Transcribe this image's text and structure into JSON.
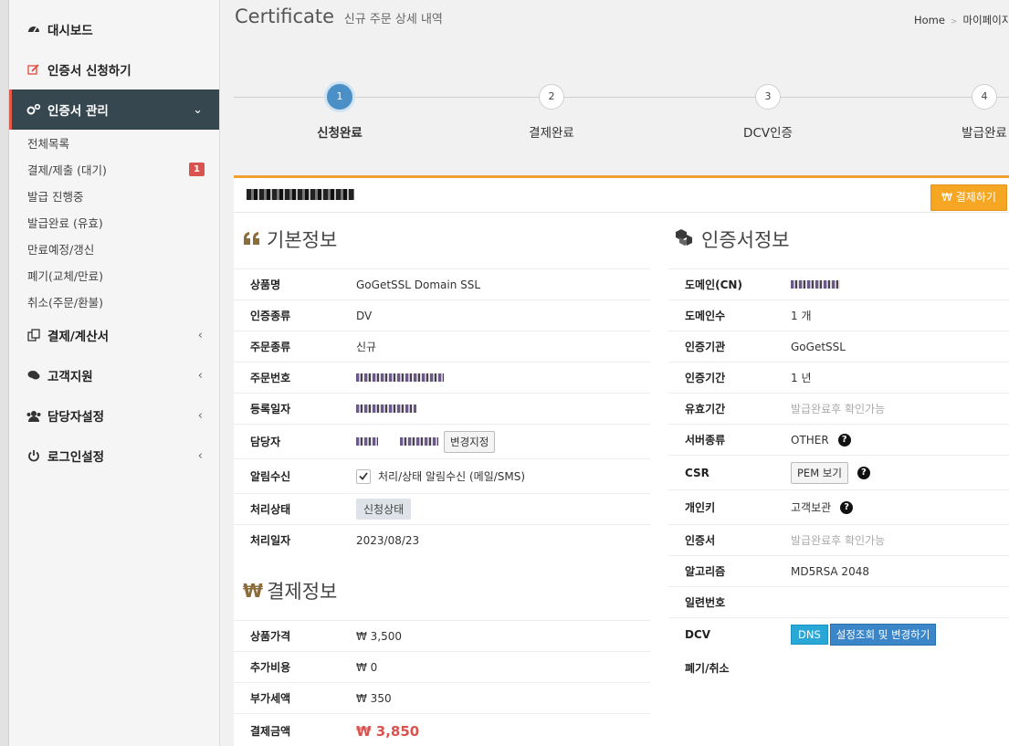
{
  "sidebar": {
    "dashboard": "대시보드",
    "apply": "인증서 신청하기",
    "manage": "인증서 관리",
    "sub": [
      "전체목록",
      "결제/제출 (대기)",
      "발급 진행중",
      "발급완료 (유효)",
      "만료예정/갱신",
      "폐기(교체/만료)",
      "취소(주문/환불)"
    ],
    "pending_count": "1",
    "payment": "결제/계산서",
    "support": "고객지원",
    "contacts": "담당자설정",
    "login": "로그인설정"
  },
  "header": {
    "title": "Certificate",
    "subtitle": "신규 주문 상세 내역",
    "breadcrumb_home": "Home",
    "breadcrumb_page": "마이페이지"
  },
  "steps": [
    {
      "num": "1",
      "label": "신청완료"
    },
    {
      "num": "2",
      "label": "결제완료"
    },
    {
      "num": "3",
      "label": "DCV인증"
    },
    {
      "num": "4",
      "label": "발급완료"
    }
  ],
  "panel": {
    "pay_button": "₩ 결제하기"
  },
  "basic": {
    "heading": "기본정보",
    "product_label": "상품명",
    "product_value": "GoGetSSL Domain SSL",
    "certtype_label": "인증종류",
    "certtype_value": "DV",
    "ordertype_label": "주문종류",
    "ordertype_value": "신규",
    "orderno_label": "주문번호",
    "regdate_label": "등록일자",
    "manager_label": "담당자",
    "manager_button": "변경지정",
    "notify_label": "알림수신",
    "notify_value": "처리/상태 알림수신 (메일/SMS)",
    "status_label": "처리상태",
    "status_value": "신청상태",
    "procdate_label": "처리일자",
    "procdate_value": "2023/08/23"
  },
  "payment": {
    "heading": "결제정보",
    "price_label": "상품가격",
    "price_value": "₩ 3,500",
    "extra_label": "추가비용",
    "extra_value": "₩ 0",
    "vat_label": "부가세액",
    "vat_value": "₩ 350",
    "total_label": "결제금액",
    "total_value": "₩ 3,850"
  },
  "cert": {
    "heading": "인증서정보",
    "domain_label": "도메인(CN)",
    "domains_label": "도메인수",
    "domains_value": "1 개",
    "ca_label": "인증기관",
    "ca_value": "GoGetSSL",
    "period_label": "인증기간",
    "period_value": "1 년",
    "valid_label": "유효기간",
    "valid_value": "발급완료후 확인가능",
    "server_label": "서버종류",
    "server_value": "OTHER",
    "csr_label": "CSR",
    "csr_button": "PEM 보기",
    "key_label": "개인키",
    "key_value": "고객보관",
    "certfile_label": "인증서",
    "certfile_value": "발급완료후 확인가능",
    "algo_label": "알고리즘",
    "algo_value": "MD5RSA 2048",
    "serial_label": "일련번호",
    "dcv_label": "DCV",
    "dcv_badge": "DNS",
    "dcv_button": "설정조회 및 변경하기",
    "revoke_label": "폐기/취소"
  }
}
